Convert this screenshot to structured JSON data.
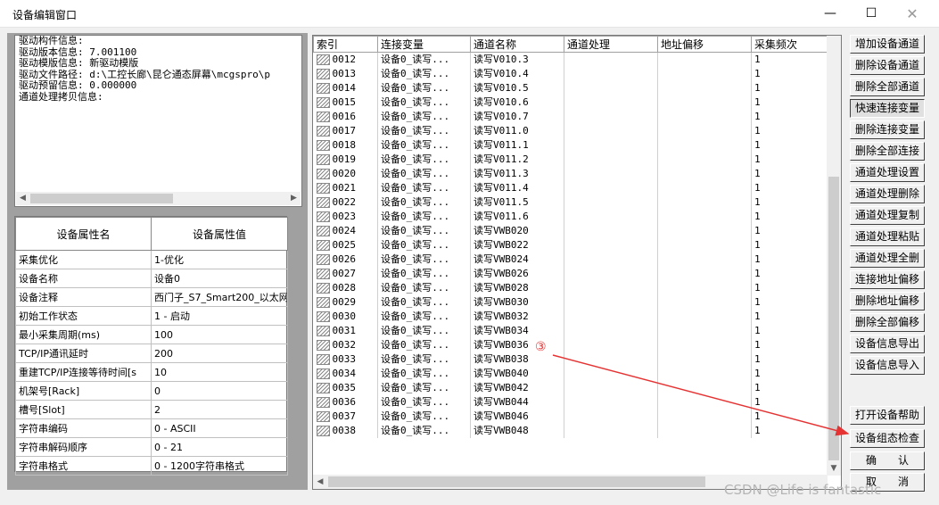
{
  "window": {
    "title": "设备编辑窗口",
    "minimize": "—",
    "maximize": "☐",
    "close": "✕"
  },
  "driver_info": [
    "驱动构件信息:",
    "驱动版本信息:  7.001100",
    "驱动模版信息:  新驱动模版",
    "驱动文件路径:  d:\\工控长廊\\昆仑通态屏幕\\mcgspro\\p",
    "驱动预留信息:  0.000000",
    "通道处理拷贝信息:"
  ],
  "properties": {
    "headers": [
      "设备属性名",
      "设备属性值"
    ],
    "rows": [
      [
        "采集优化",
        "1-优化"
      ],
      [
        "设备名称",
        "设备0"
      ],
      [
        "设备注释",
        "西门子_S7_Smart200_以太网"
      ],
      [
        "初始工作状态",
        "1 - 启动"
      ],
      [
        "最小采集周期(ms)",
        "100"
      ],
      [
        "TCP/IP通讯延时",
        "200"
      ],
      [
        "重建TCP/IP连接等待时间[s",
        "10"
      ],
      [
        "机架号[Rack]",
        "0"
      ],
      [
        "槽号[Slot]",
        "2"
      ],
      [
        "字符串编码",
        "0 - ASCII"
      ],
      [
        "字符串解码顺序",
        "0 - 21"
      ],
      [
        "字符串格式",
        "0 - 1200字符串格式"
      ]
    ]
  },
  "channels": {
    "headers": [
      "索引",
      "连接变量",
      "通道名称",
      "通道处理",
      "地址偏移",
      "采集频次"
    ],
    "rows": [
      [
        "0012",
        "设备0_读写...",
        "读写V010.3",
        "",
        "",
        "1"
      ],
      [
        "0013",
        "设备0_读写...",
        "读写V010.4",
        "",
        "",
        "1"
      ],
      [
        "0014",
        "设备0_读写...",
        "读写V010.5",
        "",
        "",
        "1"
      ],
      [
        "0015",
        "设备0_读写...",
        "读写V010.6",
        "",
        "",
        "1"
      ],
      [
        "0016",
        "设备0_读写...",
        "读写V010.7",
        "",
        "",
        "1"
      ],
      [
        "0017",
        "设备0_读写...",
        "读写V011.0",
        "",
        "",
        "1"
      ],
      [
        "0018",
        "设备0_读写...",
        "读写V011.1",
        "",
        "",
        "1"
      ],
      [
        "0019",
        "设备0_读写...",
        "读写V011.2",
        "",
        "",
        "1"
      ],
      [
        "0020",
        "设备0_读写...",
        "读写V011.3",
        "",
        "",
        "1"
      ],
      [
        "0021",
        "设备0_读写...",
        "读写V011.4",
        "",
        "",
        "1"
      ],
      [
        "0022",
        "设备0_读写...",
        "读写V011.5",
        "",
        "",
        "1"
      ],
      [
        "0023",
        "设备0_读写...",
        "读写V011.6",
        "",
        "",
        "1"
      ],
      [
        "0024",
        "设备0_读写...",
        "读写VWB020",
        "",
        "",
        "1"
      ],
      [
        "0025",
        "设备0_读写...",
        "读写VWB022",
        "",
        "",
        "1"
      ],
      [
        "0026",
        "设备0_读写...",
        "读写VWB024",
        "",
        "",
        "1"
      ],
      [
        "0027",
        "设备0_读写...",
        "读写VWB026",
        "",
        "",
        "1"
      ],
      [
        "0028",
        "设备0_读写...",
        "读写VWB028",
        "",
        "",
        "1"
      ],
      [
        "0029",
        "设备0_读写...",
        "读写VWB030",
        "",
        "",
        "1"
      ],
      [
        "0030",
        "设备0_读写...",
        "读写VWB032",
        "",
        "",
        "1"
      ],
      [
        "0031",
        "设备0_读写...",
        "读写VWB034",
        "",
        "",
        "1"
      ],
      [
        "0032",
        "设备0_读写...",
        "读写VWB036",
        "",
        "",
        "1"
      ],
      [
        "0033",
        "设备0_读写...",
        "读写VWB038",
        "",
        "",
        "1"
      ],
      [
        "0034",
        "设备0_读写...",
        "读写VWB040",
        "",
        "",
        "1"
      ],
      [
        "0035",
        "设备0_读写...",
        "读写VWB042",
        "",
        "",
        "1"
      ],
      [
        "0036",
        "设备0_读写...",
        "读写VWB044",
        "",
        "",
        "1"
      ],
      [
        "0037",
        "设备0_读写...",
        "读写VWB046",
        "",
        "",
        "1"
      ],
      [
        "0038",
        "设备0_读写...",
        "读写VWB048",
        "",
        "",
        "1"
      ]
    ]
  },
  "buttons": {
    "add_channel": "增加设备通道",
    "delete_channel": "删除设备通道",
    "delete_all_channels": "删除全部通道",
    "quick_connect_var": "快速连接变量",
    "delete_connect_var": "删除连接变量",
    "delete_all_connect": "删除全部连接",
    "channel_proc_set": "通道处理设置",
    "channel_proc_delete": "通道处理删除",
    "channel_proc_copy": "通道处理复制",
    "channel_proc_paste": "通道处理粘贴",
    "channel_proc_delete_all": "通道处理全删",
    "connect_addr_offset": "连接地址偏移",
    "delete_addr_offset": "删除地址偏移",
    "delete_all_offset": "删除全部偏移",
    "export_info": "设备信息导出",
    "import_info": "设备信息导入",
    "open_help": "打开设备帮助",
    "config_check": "设备组态检查",
    "confirm": "确　　认",
    "cancel": "取　　消"
  },
  "annotation": {
    "label": "③",
    "color": "#e53333"
  },
  "watermark": "CSDN @Life is fantastic"
}
